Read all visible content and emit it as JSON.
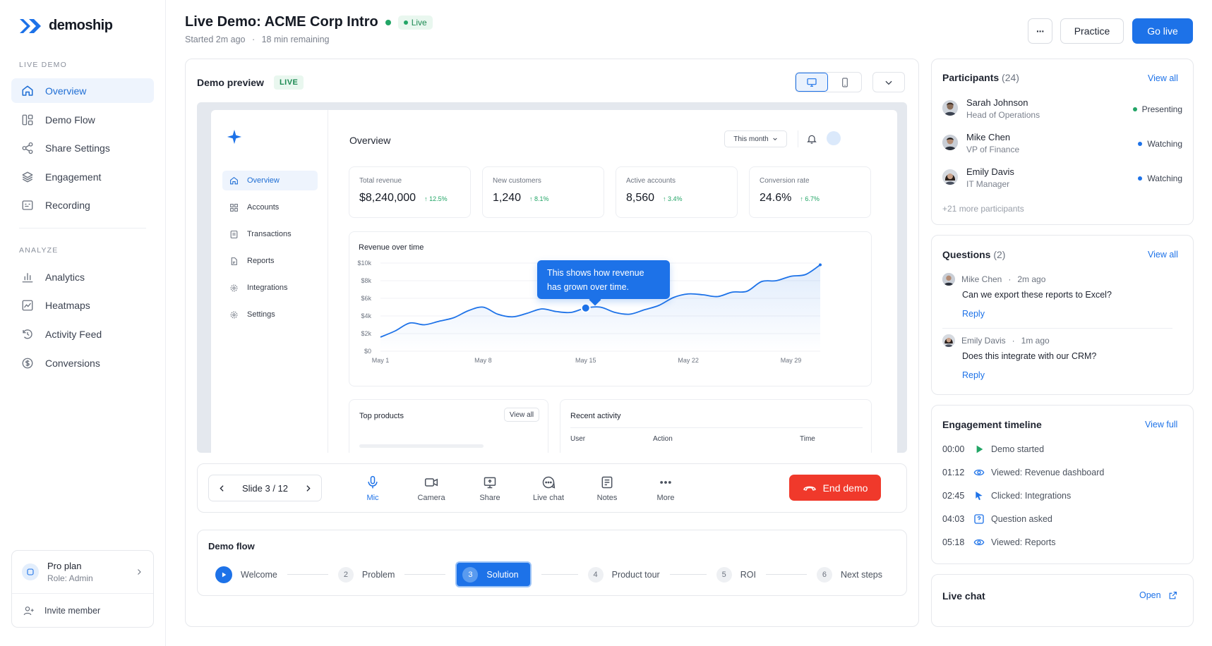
{
  "brand": {
    "name": "demoship"
  },
  "sidebar": {
    "section_live": "LIVE DEMO",
    "live_items": [
      {
        "label": "Overview",
        "icon": "home-icon",
        "active": true
      },
      {
        "label": "Demo Flow",
        "icon": "flow-icon"
      },
      {
        "label": "Share Settings",
        "icon": "share-icon"
      },
      {
        "label": "Engagement",
        "icon": "layers-icon"
      },
      {
        "label": "Recording",
        "icon": "recording-icon"
      }
    ],
    "section_analyze": "ANALYZE",
    "analyze_items": [
      {
        "label": "Analytics",
        "icon": "bar-chart-icon"
      },
      {
        "label": "Heatmaps",
        "icon": "heatmap-icon"
      },
      {
        "label": "Activity Feed",
        "icon": "activity-icon"
      },
      {
        "label": "Conversions",
        "icon": "dollar-icon"
      }
    ],
    "plan": {
      "name": "Pro plan",
      "role": "Role: Admin"
    },
    "invite": "Invite member"
  },
  "header": {
    "title": "Live Demo: ACME Corp Intro",
    "badge": "Live",
    "started": "Started 2m ago",
    "remaining": "18 min remaining",
    "more": "···",
    "practice": "Practice",
    "go_live": "Go live"
  },
  "preview": {
    "title": "Demo preview",
    "badge": "LIVE",
    "inner": {
      "nav": [
        "Overview",
        "Accounts",
        "Transactions",
        "Reports",
        "Integrations",
        "Settings"
      ],
      "page_title": "Overview",
      "range": "This month",
      "kpis": [
        {
          "label": "Total revenue",
          "value": "$8,240,000",
          "delta": "↑ 12.5%"
        },
        {
          "label": "New customers",
          "value": "1,240",
          "delta": "↑ 8.1%"
        },
        {
          "label": "Active accounts",
          "value": "8,560",
          "delta": "↑ 3.4%"
        },
        {
          "label": "Conversion rate",
          "value": "24.6%",
          "delta": "↑ 6.7%"
        }
      ],
      "chart_title": "Revenue over time",
      "tooltip": "This shows how revenue has grown over time.",
      "top_products": "Top products",
      "view_all": "View all",
      "recent_activity": "Recent activity",
      "table_headers": [
        "User",
        "Action",
        "Time"
      ]
    }
  },
  "chart_data": {
    "type": "line",
    "title": "Revenue over time",
    "xlabel": "",
    "ylabel": "",
    "x": [
      "May 1",
      "May 2",
      "May 3",
      "May 4",
      "May 5",
      "May 6",
      "May 7",
      "May 8",
      "May 9",
      "May 10",
      "May 11",
      "May 12",
      "May 13",
      "May 14",
      "May 15",
      "May 16",
      "May 17",
      "May 18",
      "May 19",
      "May 20",
      "May 21",
      "May 22",
      "May 23",
      "May 24",
      "May 25",
      "May 26",
      "May 27",
      "May 28",
      "May 29",
      "May 30",
      "May 31"
    ],
    "x_ticks": [
      "May 1",
      "May 8",
      "May 15",
      "May 22",
      "May 29"
    ],
    "y_ticks": [
      "$0",
      "$2k",
      "$4k",
      "$6k",
      "$8k",
      "$10k"
    ],
    "ylim": [
      0,
      10000
    ],
    "series": [
      {
        "values": [
          1600,
          2300,
          3200,
          3000,
          3400,
          3800,
          4600,
          5000,
          4200,
          3900,
          4300,
          4800,
          4500,
          4400,
          4900,
          5000,
          4400,
          4200,
          4700,
          5200,
          6100,
          6500,
          6400,
          6200,
          6700,
          6800,
          7900,
          8000,
          8500,
          8700,
          9800
        ]
      }
    ],
    "highlight": {
      "x": "May 15",
      "value": 4900
    }
  },
  "controls": {
    "slide": "Slide 3 / 12",
    "items": [
      {
        "label": "Mic",
        "icon": "mic-icon",
        "on": true
      },
      {
        "label": "Camera",
        "icon": "camera-icon"
      },
      {
        "label": "Share",
        "icon": "screen-share-icon"
      },
      {
        "label": "Live chat",
        "icon": "chat-icon"
      },
      {
        "label": "Notes",
        "icon": "notes-icon"
      },
      {
        "label": "More",
        "icon": "more-icon"
      }
    ],
    "end": "End demo"
  },
  "flow": {
    "title": "Demo flow",
    "steps": [
      {
        "num": "",
        "label": "Welcome"
      },
      {
        "num": "2",
        "label": "Problem"
      },
      {
        "num": "3",
        "label": "Solution",
        "active": true
      },
      {
        "num": "4",
        "label": "Product tour"
      },
      {
        "num": "5",
        "label": "ROI"
      },
      {
        "num": "6",
        "label": "Next steps"
      }
    ]
  },
  "participants": {
    "title": "Participants",
    "count": "(24)",
    "view_all": "View all",
    "list": [
      {
        "name": "Sarah Johnson",
        "role": "Head of Operations",
        "status": "Presenting",
        "color": "#22a566"
      },
      {
        "name": "Mike Chen",
        "role": "VP of Finance",
        "status": "Watching",
        "color": "#1d72e8"
      },
      {
        "name": "Emily Davis",
        "role": "IT Manager",
        "status": "Watching",
        "color": "#1d72e8"
      }
    ],
    "more": "+21 more participants"
  },
  "questions": {
    "title": "Questions",
    "count": "(2)",
    "view_all": "View all",
    "list": [
      {
        "name": "Mike Chen",
        "time": "2m ago",
        "text": "Can we export these reports to Excel?",
        "reply": "Reply"
      },
      {
        "name": "Emily Davis",
        "time": "1m ago",
        "text": "Does this integrate with our CRM?",
        "reply": "Reply"
      }
    ]
  },
  "timeline": {
    "title": "Engagement timeline",
    "view_full": "View full",
    "events": [
      {
        "time": "00:00",
        "text": "Demo started",
        "icon": "play-icon"
      },
      {
        "time": "01:12",
        "text": "Viewed: Revenue dashboard",
        "icon": "eye-icon"
      },
      {
        "time": "02:45",
        "text": "Clicked: Integrations",
        "icon": "cursor-icon"
      },
      {
        "time": "04:03",
        "text": "Question asked",
        "icon": "question-icon"
      },
      {
        "time": "05:18",
        "text": "Viewed: Reports",
        "icon": "eye-icon"
      }
    ]
  },
  "live_chat": {
    "title": "Live chat",
    "open": "Open"
  },
  "colors": {
    "accent": "#1d72e8",
    "live": "#22a566",
    "danger": "#f0392b"
  }
}
